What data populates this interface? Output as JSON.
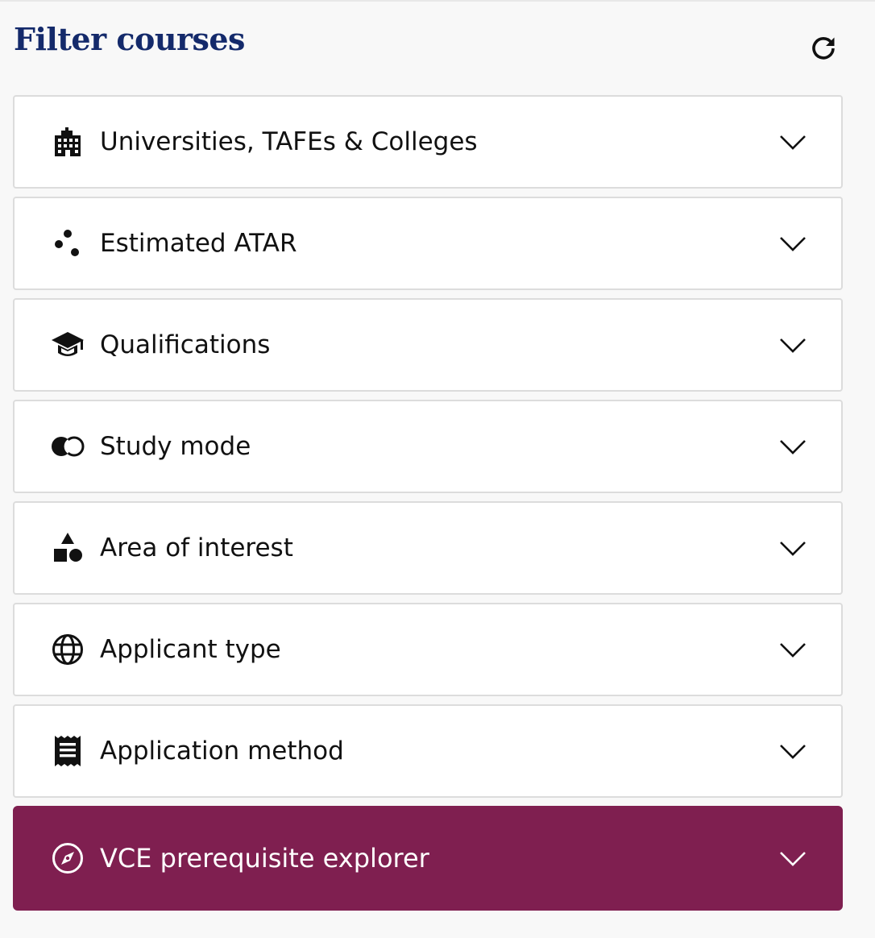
{
  "header": {
    "title": "Filter courses",
    "reset_icon": "refresh-icon"
  },
  "filters": [
    {
      "label": "Universities, TAFEs & Colleges",
      "icon": "building-icon"
    },
    {
      "label": "Estimated ATAR",
      "icon": "dots-icon"
    },
    {
      "label": "Qualifications",
      "icon": "graduation-cap-icon"
    },
    {
      "label": "Study mode",
      "icon": "overlapping-circles-icon"
    },
    {
      "label": "Area of interest",
      "icon": "shapes-icon"
    },
    {
      "label": "Applicant type",
      "icon": "globe-icon"
    },
    {
      "label": "Application method",
      "icon": "receipt-icon"
    },
    {
      "label": "VCE prerequisite explorer",
      "icon": "compass-icon"
    }
  ],
  "colors": {
    "title": "#142a6b",
    "featured_background": "#7f1f50",
    "item_border": "#dcdcdc",
    "page_background": "#f8f8f8"
  }
}
